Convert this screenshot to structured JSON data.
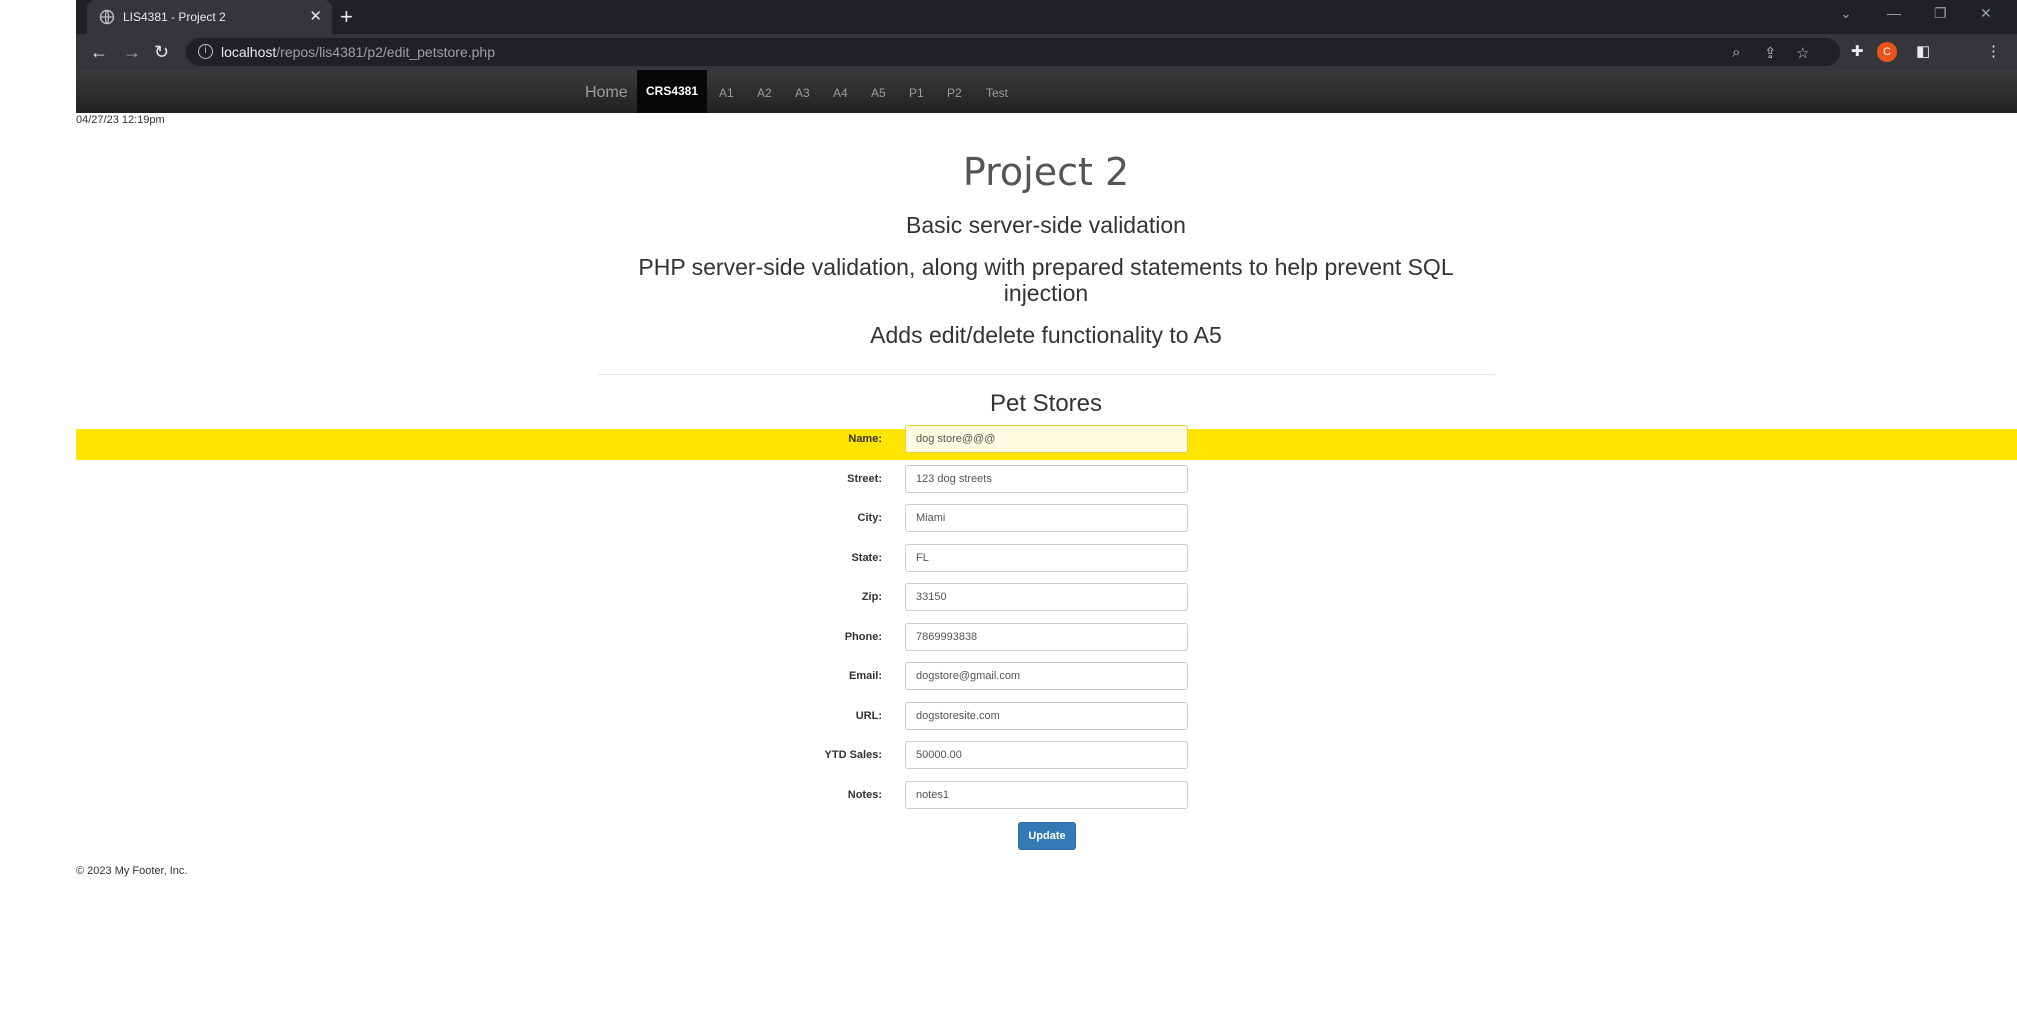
{
  "browser": {
    "tab_title": "LIS4381 - Project 2",
    "url_host": "localhost",
    "url_path": "/repos/lis4381/p2/edit_petstore.php",
    "profile_initial": "C"
  },
  "nav": {
    "brand": "Home",
    "active": "CRS4381",
    "items": [
      "A1",
      "A2",
      "A3",
      "A4",
      "A5",
      "P1",
      "P2",
      "Test"
    ]
  },
  "timestamp": "04/27/23 12:19pm",
  "header": {
    "title": "Project 2",
    "subtitle1": "Basic server-side validation",
    "subtitle2": "PHP server-side validation, along with prepared statements to help prevent SQL injection",
    "subtitle3": "Adds edit/delete functionality to A5"
  },
  "form": {
    "title": "Pet Stores",
    "fields": [
      {
        "label": "Name:",
        "value": "dog store@@@"
      },
      {
        "label": "Street:",
        "value": "123 dog streets"
      },
      {
        "label": "City:",
        "value": "Miami"
      },
      {
        "label": "State:",
        "value": "FL"
      },
      {
        "label": "Zip:",
        "value": "33150"
      },
      {
        "label": "Phone:",
        "value": "7869993838"
      },
      {
        "label": "Email:",
        "value": "dogstore@gmail.com"
      },
      {
        "label": "URL:",
        "value": "dogstoresite.com"
      },
      {
        "label": "YTD Sales:",
        "value": "50000.00"
      },
      {
        "label": "Notes:",
        "value": "notes1"
      }
    ],
    "submit_label": "Update"
  },
  "footer": "© 2023 My Footer, Inc.",
  "colors": {
    "highlight": "#ffe500",
    "button": "#337ab7",
    "navbar": "#222222"
  }
}
